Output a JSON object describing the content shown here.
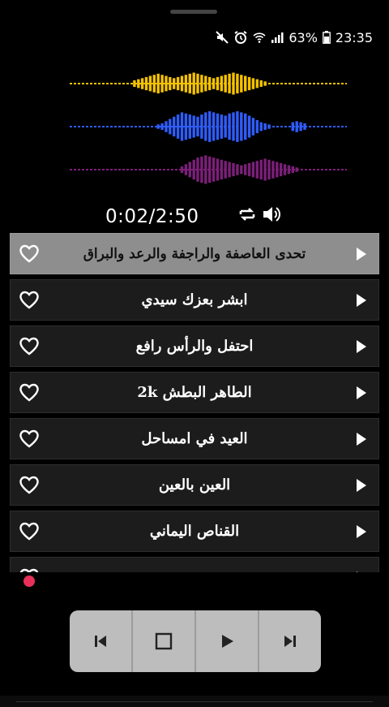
{
  "status": {
    "battery": "63%",
    "time": "23:35"
  },
  "visualizer": {
    "colors": [
      "#f5c200",
      "#2f5cff",
      "#7b1f78"
    ],
    "icons": [
      "waveform-yellow",
      "waveform-blue",
      "waveform-purple"
    ]
  },
  "player": {
    "time": "0:02/2:50",
    "icons": {
      "repeat": "repeat-icon",
      "volume": "volume-icon"
    }
  },
  "playlist": [
    {
      "title": "تحدى العاصفة والراجفة والرعد والبراق",
      "active": true
    },
    {
      "title": "ابشر بعزك سيدي",
      "active": false
    },
    {
      "title": "احتفل والرأس رافع",
      "active": false
    },
    {
      "title": "الطاهر البطش 2k",
      "active": false
    },
    {
      "title": "العيد في امساحل",
      "active": false
    },
    {
      "title": "العين بالعين",
      "active": false
    },
    {
      "title": "القناص اليماني",
      "active": false
    },
    {
      "title": "",
      "active": false
    }
  ],
  "controls": {
    "buttons": [
      "skip-previous-icon",
      "stop-icon",
      "play-icon",
      "skip-next-icon"
    ],
    "color_bg": "#bdbdbd",
    "color_icon": "#222222"
  },
  "accent": "#e8305a"
}
